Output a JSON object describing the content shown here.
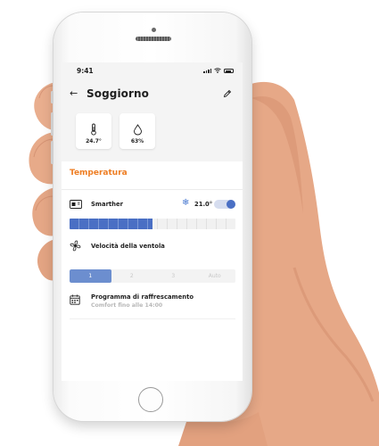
{
  "status_bar": {
    "time": "9:41"
  },
  "header": {
    "title": "Soggiorno",
    "back_icon": "arrow-left-icon",
    "edit_icon": "pencil-icon"
  },
  "sensors": [
    {
      "icon": "thermometer-icon",
      "value": "24.7°"
    },
    {
      "icon": "humidity-drop-icon",
      "value": "63%"
    }
  ],
  "temperature_section": {
    "title": "Temperatura",
    "device": {
      "name": "Smarther",
      "mode_icon": "snowflake-icon",
      "setpoint": "21.0°",
      "enabled": true
    },
    "level_fraction": 0.5
  },
  "fan": {
    "label": "Velocità della ventola",
    "speeds": [
      "1",
      "2",
      "3",
      "Auto"
    ],
    "selected": "1"
  },
  "program": {
    "title": "Programma di raffrescamento",
    "subtitle": "Comfort fino alle 14:00"
  },
  "colors": {
    "accent_orange": "#ee7d22",
    "accent_blue": "#4a6fc4"
  }
}
